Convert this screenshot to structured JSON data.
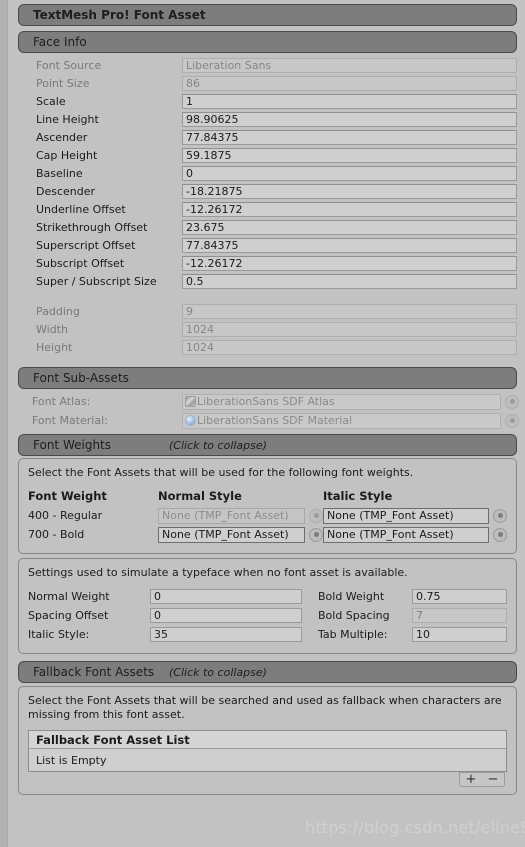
{
  "window": {
    "title": "TextMesh Pro! Font Asset"
  },
  "face_info": {
    "header": "Face Info",
    "fields": [
      {
        "label": "Font Source",
        "value": "Liberation Sans",
        "disabled": true
      },
      {
        "label": "Point Size",
        "value": "86",
        "disabled": true
      },
      {
        "label": "Scale",
        "value": "1",
        "disabled": false
      },
      {
        "label": "Line Height",
        "value": "98.90625",
        "disabled": false
      },
      {
        "label": "Ascender",
        "value": "77.84375",
        "disabled": false
      },
      {
        "label": "Cap Height",
        "value": "59.1875",
        "disabled": false
      },
      {
        "label": "Baseline",
        "value": "0",
        "disabled": false
      },
      {
        "label": "Descender",
        "value": "-18.21875",
        "disabled": false
      },
      {
        "label": "Underline Offset",
        "value": "-12.26172",
        "disabled": false
      },
      {
        "label": "Strikethrough Offset",
        "value": "23.675",
        "disabled": false
      },
      {
        "label": "Superscript Offset",
        "value": "77.84375",
        "disabled": false
      },
      {
        "label": "Subscript Offset",
        "value": "-12.26172",
        "disabled": false
      },
      {
        "label": "Super / Subscript Size",
        "value": "0.5",
        "disabled": false
      }
    ],
    "atlas_fields": [
      {
        "label": "Padding",
        "value": "9",
        "disabled": true
      },
      {
        "label": "Width",
        "value": "1024",
        "disabled": true
      },
      {
        "label": "Height",
        "value": "1024",
        "disabled": true
      }
    ]
  },
  "font_sub_assets": {
    "header": "Font Sub-Assets",
    "rows": [
      {
        "label": "Font Atlas:",
        "value": "LiberationSans SDF Atlas",
        "icon": "texture-thumbnail-icon"
      },
      {
        "label": "Font Material:",
        "value": "LiberationSans SDF Material",
        "icon": "material-sphere-icon"
      }
    ]
  },
  "font_weights": {
    "header": "Font Weights",
    "collapse_hint": "(Click to collapse)",
    "description": "Select the Font Assets that will be used for the following font weights.",
    "columns": [
      "Font Weight",
      "Normal Style",
      "Italic Style"
    ],
    "rows": [
      {
        "weight": "400 - Regular",
        "normal": {
          "value": "None (TMP_Font Asset)",
          "disabled": true
        },
        "italic": {
          "value": "None (TMP_Font Asset)",
          "disabled": false
        }
      },
      {
        "weight": "700 - Bold",
        "normal": {
          "value": "None (TMP_Font Asset)",
          "disabled": false
        },
        "italic": {
          "value": "None (TMP_Font Asset)",
          "disabled": false
        }
      }
    ]
  },
  "typeface_settings": {
    "description": "Settings used to simulate a typeface when no font asset is available.",
    "rows": [
      {
        "left_label": "Normal Weight",
        "left_value": "0",
        "left_disabled": false,
        "right_label": "Bold Weight",
        "right_value": "0.75",
        "right_disabled": false
      },
      {
        "left_label": "Spacing Offset",
        "left_value": "0",
        "left_disabled": false,
        "right_label": "Bold Spacing",
        "right_value": "7",
        "right_disabled": true
      },
      {
        "left_label": "Italic Style:",
        "left_value": "35",
        "left_disabled": false,
        "right_label": "Tab Multiple:",
        "right_value": "10",
        "right_disabled": false
      }
    ]
  },
  "fallback_font_assets": {
    "header": "Fallback Font Assets",
    "collapse_hint": "(Click to collapse)",
    "description": "Select the Font Assets that will be searched and used as fallback when characters are missing from this font asset.",
    "list_header": "Fallback Font Asset List",
    "empty_text": "List is Empty",
    "add_label": "+",
    "remove_label": "−"
  },
  "watermark": {
    "text": "https://blog.csdn.net/elineSea"
  },
  "colors": {
    "background": "#c2c2c2",
    "header_bar": "#7d7d7d",
    "field_bg": "#cfcfcf",
    "disabled_text": "#868686",
    "text": "#1b1b1b"
  }
}
